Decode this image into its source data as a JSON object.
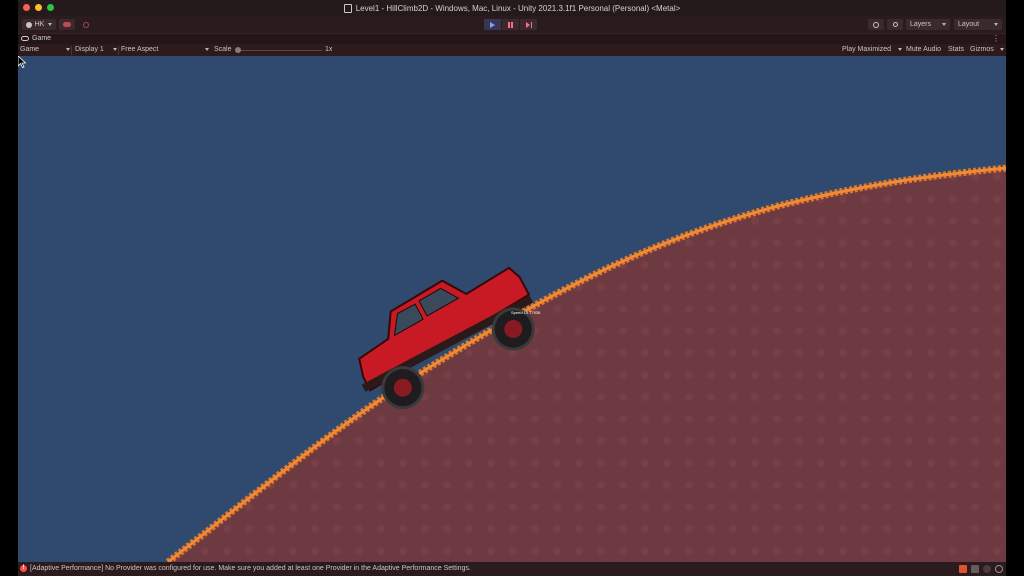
{
  "window": {
    "title": "Level1 - HillClimb2D - Windows, Mac, Linux - Unity 2021.3.1f1 Personal (Personal) <Metal>"
  },
  "toolbar": {
    "account_label": "HK",
    "layers_label": "Layers",
    "layout_label": "Layout"
  },
  "game_tab": {
    "label": "Game"
  },
  "game_controls": {
    "view_mode": "Game",
    "display": "Display 1",
    "aspect": "Free Aspect",
    "scale_label": "Scale",
    "scale_value": "1x",
    "play_mode": "Play Maximized",
    "mute_audio": "Mute Audio",
    "stats": "Stats",
    "gizmos": "Gizmos"
  },
  "scene": {
    "speed_text": "Speed 15.77036",
    "sky_color": "#2f4a6e",
    "ground_color": "#6e3a42",
    "ground_edge_color": "#e0762a",
    "car_color": "#c81a24"
  },
  "status": {
    "message": "[Adaptive Performance] No Provider was configured for use. Make sure you added at least one Provider in the Adaptive Performance Settings."
  }
}
